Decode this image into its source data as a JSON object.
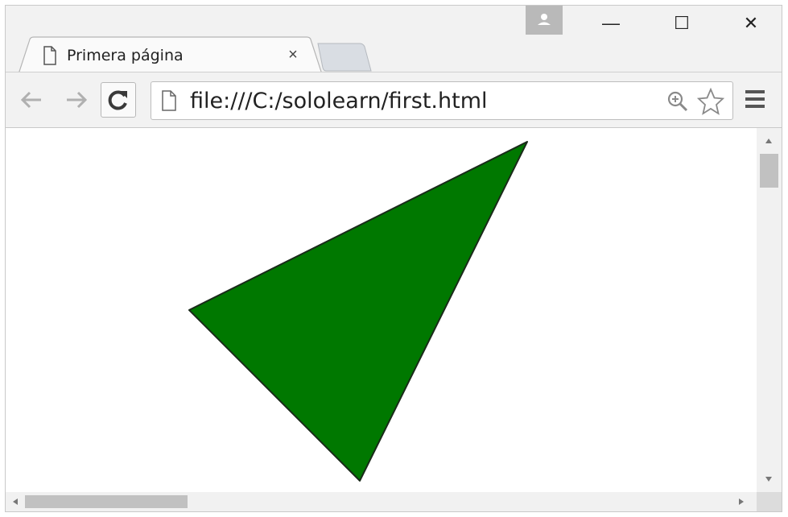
{
  "window": {
    "controls": {
      "minimize": "—",
      "maximize": "☐",
      "close": "✕"
    }
  },
  "tab": {
    "title": "Primera página",
    "close_label": "×"
  },
  "toolbar": {
    "url": "file:///C:/sololearn/first.html"
  },
  "icons": {
    "profile": "profile-icon",
    "back": "back-arrow-icon",
    "forward": "forward-arrow-icon",
    "reload": "reload-icon",
    "page": "page-icon",
    "zoom": "zoom-icon",
    "bookmark": "star-icon",
    "menu": "hamburger-menu-icon"
  },
  "content": {
    "shape": "triangle",
    "fill_color": "#007800",
    "stroke_color": "#1a2a1a"
  },
  "colors": {
    "chrome_bg": "#f2f2f2",
    "profile_bg": "#b9b9b9",
    "scrollbar_thumb": "#c1c1c1"
  }
}
